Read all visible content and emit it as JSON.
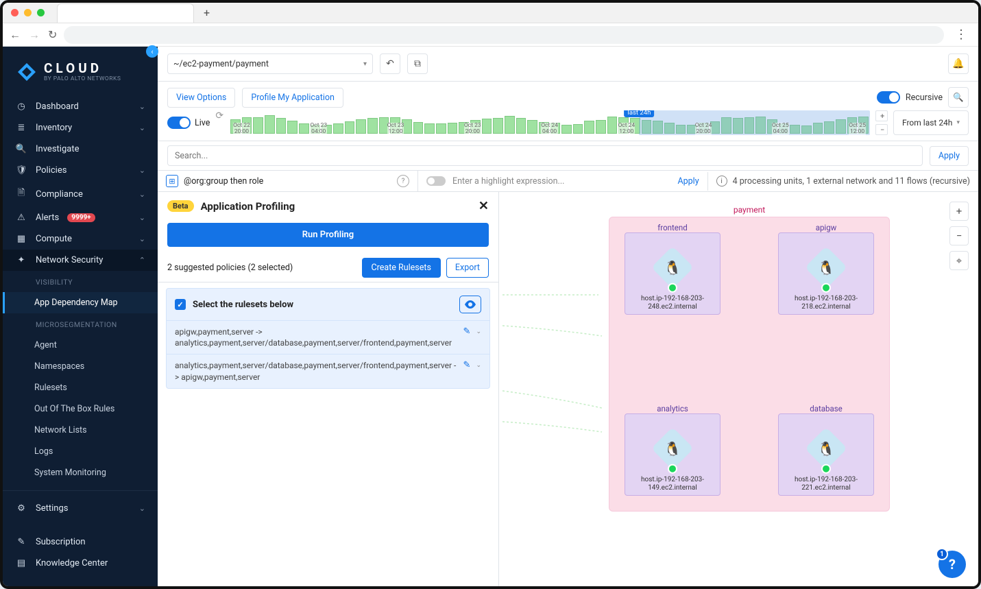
{
  "browser": {
    "new_tab_tooltip": "New Tab",
    "menu_tooltip": "Menu"
  },
  "brand": {
    "name": "CLOUD",
    "tagline": "BY PALO ALTO NETWORKS"
  },
  "sidebar": {
    "items": [
      {
        "label": "Dashboard",
        "icon": "gauge",
        "expandable": true
      },
      {
        "label": "Inventory",
        "icon": "list",
        "expandable": true
      },
      {
        "label": "Investigate",
        "icon": "search",
        "expandable": false
      },
      {
        "label": "Policies",
        "icon": "shield",
        "expandable": true
      },
      {
        "label": "Compliance",
        "icon": "doc",
        "expandable": true
      },
      {
        "label": "Alerts",
        "icon": "alert",
        "expandable": true,
        "badge": "9999+"
      },
      {
        "label": "Compute",
        "icon": "compute",
        "expandable": true
      },
      {
        "label": "Network Security",
        "icon": "network",
        "expandable": true,
        "open": true
      }
    ],
    "subsections": {
      "visibility_header": "VISIBILITY",
      "visibility_items": [
        {
          "label": "App Dependency Map",
          "selected": true
        }
      ],
      "micro_header": "MICROSEGMENTATION",
      "micro_items": [
        {
          "label": "Agent"
        },
        {
          "label": "Namespaces"
        },
        {
          "label": "Rulesets"
        },
        {
          "label": "Out Of The Box Rules"
        },
        {
          "label": "Network Lists"
        },
        {
          "label": "Logs"
        },
        {
          "label": "System Monitoring"
        }
      ]
    },
    "footer": [
      {
        "label": "Settings",
        "icon": "gear",
        "expandable": true
      },
      {
        "label": "Subscription",
        "icon": "key"
      },
      {
        "label": "Knowledge Center",
        "icon": "book"
      }
    ]
  },
  "toolbar": {
    "path": "~/ec2-payment/payment",
    "undo_tooltip": "Undo",
    "copy_tooltip": "Copy",
    "bell_tooltip": "Notifications",
    "view_options": "View Options",
    "profile_app": "Profile My Application",
    "recursive": "Recursive",
    "search_tooltip": "Search"
  },
  "timeline": {
    "live": "Live",
    "last24_badge": "last 24h",
    "range": "From last 24h",
    "ticks": [
      "Oct 22\n20:00",
      "Oct 23\n04:00",
      "Oct 23\n12:00",
      "Oct 23\n20:00",
      "Oct 24\n04:00",
      "Oct 24\n12:00",
      "Oct 24\n20:00",
      "Oct 25\n04:00",
      "Oct 25\n12:00"
    ],
    "highlight": {
      "start_pct": 64,
      "end_pct": 100
    }
  },
  "search": {
    "placeholder": "Search...",
    "apply": "Apply"
  },
  "filter": {
    "group_expr": "@org:group then role",
    "highlight_placeholder": "Enter a highlight expression...",
    "apply": "Apply",
    "stats": "4 processing units, 1 external network and 11 flows (recursive)"
  },
  "panel": {
    "beta": "Beta",
    "title": "Application Profiling",
    "run": "Run Profiling",
    "suggested": "2 suggested policies (2 selected)",
    "create": "Create Rulesets",
    "export": "Export",
    "select_head": "Select the rulesets below",
    "rules": [
      "apigw,payment,server -> analytics,payment,server/database,payment,server/frontend,payment,server",
      "analytics,payment,server/database,payment,server/frontend,payment,server -> apigw,payment,server"
    ]
  },
  "graph": {
    "group_label": "payment",
    "nodes": {
      "frontend": {
        "label": "frontend",
        "host": "host.ip-192-168-203-248.ec2.internal"
      },
      "apigw": {
        "label": "apigw",
        "host": "host.ip-192-168-203-218.ec2.internal"
      },
      "analytics": {
        "label": "analytics",
        "host": "host.ip-192-168-203-149.ec2.internal"
      },
      "database": {
        "label": "database",
        "host": "host.ip-192-168-203-221.ec2.internal"
      }
    },
    "controls": {
      "zoom_in": "+",
      "zoom_out": "−",
      "fit": "⌖"
    }
  },
  "help": {
    "count": "1"
  }
}
